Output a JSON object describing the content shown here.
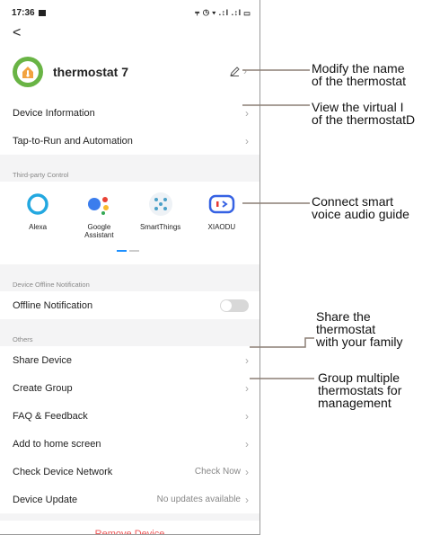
{
  "status": {
    "time": "17:36",
    "indicators": "⫧ ◷ ▾ .↕l .↕l ▭"
  },
  "nav": {
    "back": "<"
  },
  "device": {
    "name": "thermostat 7",
    "edit_icon": "pencil-icon"
  },
  "rows_top": [
    {
      "label": "Device Information"
    },
    {
      "label": "Tap-to-Run and Automation"
    }
  ],
  "third_party": {
    "title": "Third-party Control",
    "items": [
      {
        "label": "Alexa",
        "icon": "alexa-icon"
      },
      {
        "label": "Google\nAssistant",
        "icon": "google-assistant-icon"
      },
      {
        "label": "SmartThings",
        "icon": "smartthings-icon"
      },
      {
        "label": "XIAODU",
        "icon": "xiaodu-icon"
      }
    ]
  },
  "offline": {
    "title": "Device Offline Notification",
    "label": "Offline Notification",
    "enabled": false
  },
  "others": {
    "title": "Others",
    "rows": [
      {
        "label": "Share Device",
        "value": ""
      },
      {
        "label": "Create Group",
        "value": ""
      },
      {
        "label": "FAQ & Feedback",
        "value": ""
      },
      {
        "label": "Add to home screen",
        "value": ""
      },
      {
        "label": "Check Device Network",
        "value": "Check Now"
      },
      {
        "label": "Device Update",
        "value": "No updates available"
      }
    ]
  },
  "remove": {
    "label": "Remove Device"
  },
  "annotations": {
    "a1": [
      "Modify the name",
      "of the thermostat"
    ],
    "a2": [
      "View the virtual I",
      "of the thermostatD"
    ],
    "a3": [
      "Connect smart",
      "voice audio guide"
    ],
    "a4": [
      "Share the",
      "thermostat",
      "with your family"
    ],
    "a5": [
      "Group multiple",
      "thermostats for",
      "management"
    ]
  }
}
